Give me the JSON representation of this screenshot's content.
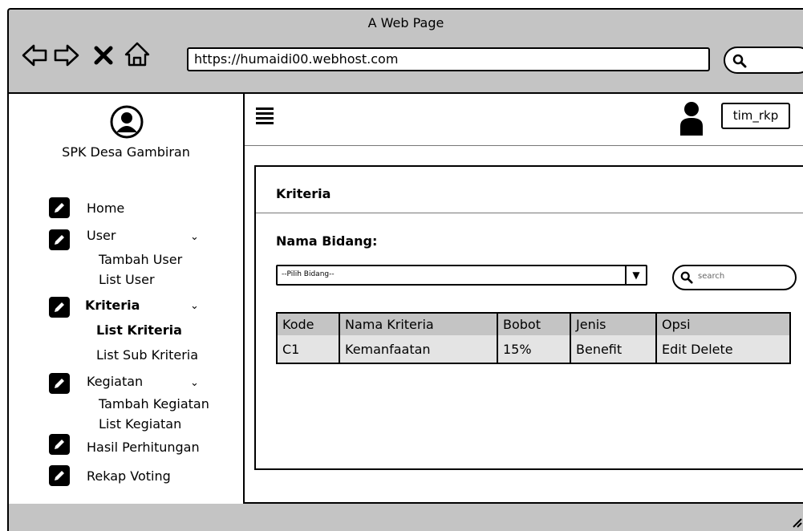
{
  "window": {
    "title": "A Web Page"
  },
  "browser": {
    "nav_icons": [
      "back-arrow-icon",
      "forward-arrow-icon",
      "close-x-icon",
      "home-icon"
    ],
    "url": "https://humaidi00.webhost.com",
    "search_icon": "search-icon"
  },
  "sidebar": {
    "avatar_icon": "user-circle-icon",
    "brand": "SPK Desa Gambiran",
    "items": [
      {
        "label": "Home",
        "icon": "edit-icon"
      },
      {
        "label": "User",
        "icon": "edit-icon",
        "subitems": [
          "Tambah User",
          "List User"
        ]
      },
      {
        "label": "Kriteria",
        "icon": "edit-icon",
        "subitems": [
          "List Kriteria",
          "List Sub Kriteria"
        ]
      },
      {
        "label": "Kegiatan",
        "icon": "edit-icon",
        "subitems": [
          "Tambah Kegiatan",
          "List Kegiatan"
        ]
      },
      {
        "label": "Hasil Perhitungan",
        "icon": "edit-icon"
      },
      {
        "label": "Rekap Voting",
        "icon": "edit-icon"
      }
    ]
  },
  "topbar": {
    "menu_icon": "hamburger-icon",
    "user_icon": "user-icon",
    "username": "tim_rkp"
  },
  "main": {
    "card_title": "Kriteria",
    "field_label": "Nama Bidang:",
    "select_value": "--Pilih Bidang--",
    "search_placeholder": "search",
    "table": {
      "columns": [
        "Kode",
        "Nama Kriteria",
        "Bobot",
        "Jenis",
        "Opsi"
      ],
      "rows": [
        [
          "C1",
          "Kemanfaatan",
          "15%",
          "Benefit",
          "Edit Delete"
        ]
      ]
    }
  }
}
